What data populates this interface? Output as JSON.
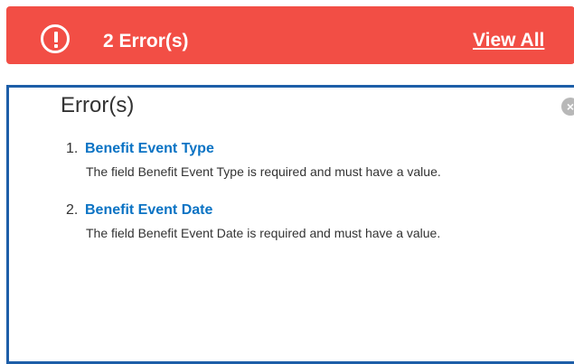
{
  "banner": {
    "icon": "exclamation-circle-icon",
    "count_label": "2 Error(s)",
    "view_all_label": "View All",
    "background_color": "#f24e45"
  },
  "panel": {
    "title": "Error(s)",
    "close_icon": "close-icon",
    "close_symbol": "×",
    "accent_color": "#1d5ea8",
    "errors": [
      {
        "number": "1.",
        "field": "Benefit Event Type",
        "message": "The field Benefit Event Type is required and must have a value."
      },
      {
        "number": "2.",
        "field": "Benefit Event Date",
        "message": "The field Benefit Event Date is required and must have a value."
      }
    ]
  }
}
